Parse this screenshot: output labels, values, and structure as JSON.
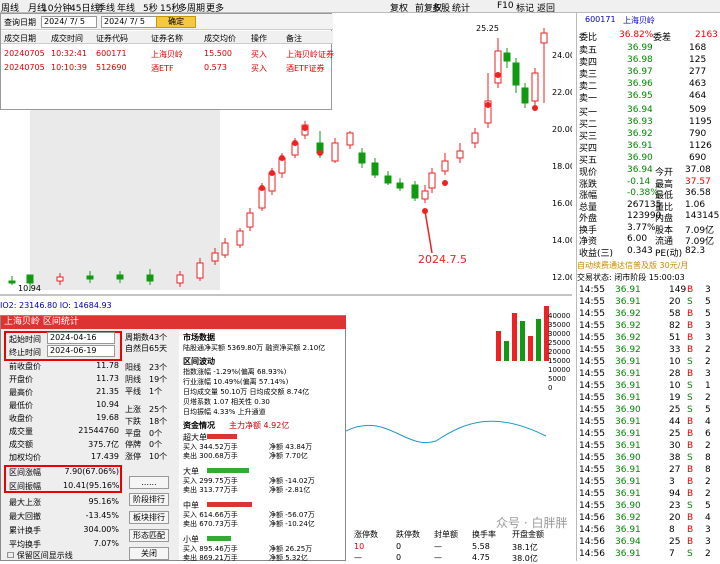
{
  "topbar": [
    "周线",
    "月线",
    "10分钟",
    "45日线",
    "季线",
    "年线",
    "5秒",
    "15秒",
    "多周期",
    "更多",
    "复权",
    "前复权",
    "多股",
    "统计",
    "F10",
    "标记",
    "返回"
  ],
  "query": {
    "label": "查询日期",
    "date1": "2024/ 7/ 5",
    "date2": "2024/ 7/ 5",
    "confirm": "确定",
    "headers": [
      "成交日期",
      "成交时间",
      "证券代码",
      "证券名称",
      "成交均价",
      "操作",
      "备注"
    ],
    "rows": [
      [
        "20240705",
        "10:32:41",
        "600171",
        "上海贝岭",
        "15.500",
        "买入",
        "上海贝岭证券"
      ],
      [
        "20240705",
        "10:10:39",
        "512690",
        "酒ETF",
        "0.573",
        "买入",
        "酒ETF证券"
      ]
    ]
  },
  "chart": {
    "top_label": "25.25",
    "low_label": "10.94",
    "annotation": "2024.7.5",
    "price_ticks": [
      "24.00",
      "22.00",
      "20.00",
      "18.00",
      "16.00",
      "14.00",
      "12.00"
    ],
    "vol_label": "IO2: 23146.80  IO: 14684.93",
    "vol_ticks": [
      "40000",
      "35000",
      "30000",
      "25000",
      "20000",
      "15000",
      "10000",
      "5000",
      "0"
    ]
  },
  "stats": {
    "title": "上海贝岭 区间统计",
    "start_label": "起始时间",
    "start": "2024-04-16",
    "end_label": "终止时间",
    "end": "2024-06-19",
    "left": [
      [
        "前收盘价",
        "11.78"
      ],
      [
        "开盘价",
        "11.73"
      ],
      [
        "最高价",
        "21.35"
      ],
      [
        "最低价",
        "10.94"
      ],
      [
        "收盘价",
        "19.68"
      ],
      [
        "成交量",
        "21544760"
      ],
      [
        "成交额",
        "375.7亿"
      ],
      [
        "加权均价",
        "17.439"
      ],
      [
        "区间涨幅",
        "7.90(67.06%)"
      ],
      [
        "区间振幅",
        "10.41(95.16%)"
      ],
      [
        "最大上涨",
        "95.16%"
      ],
      [
        "最大回撤",
        "-13.45%"
      ],
      [
        "累计换手",
        "304.00%"
      ],
      [
        "平均换手",
        "7.07%"
      ]
    ],
    "show_check": "保留区间显示线",
    "mid": [
      [
        "周期数",
        "43个"
      ],
      [
        "自然日",
        "65天"
      ],
      [
        "阳线",
        "23个"
      ],
      [
        "阴线",
        "19个"
      ],
      [
        "平线",
        "1个"
      ],
      [
        "上涨",
        "25个"
      ],
      [
        "下跌",
        "18个"
      ],
      [
        "平盘",
        "0个"
      ],
      [
        "停牌",
        "0个"
      ],
      [
        "涨停",
        "10个"
      ]
    ],
    "buttons": [
      "......",
      "阶段排行",
      "板块排行",
      "形态匹配",
      "关闭"
    ],
    "market_title": "市场数据",
    "market_line": "陆股通净买额 5369.80万 融资净买额 2.10亿",
    "band_title": "区间波动",
    "band_lines": [
      "指数涨幅 -1.29%(偏离 68.93%)",
      "行业涨幅 10.49%(偏离 57.14%)",
      "日均成交量 50.10万  日均成交额 8.74亿",
      "贝塔系数 1.07  相关性 0.30",
      "日均振幅 4.33%  上升通道"
    ],
    "fund_title": "资金情况",
    "fund_main": "主力净额 4.92亿",
    "funds": [
      [
        "超大单",
        "买入 344.52万手",
        "卖出 300.68万手",
        "净额 43.84万",
        "净额 7.70亿"
      ],
      [
        "大单",
        "买入 299.75万手",
        "卖出 313.77万手",
        "净额 -14.02万",
        "净额 -2.81亿"
      ],
      [
        "中单",
        "买入 614.66万手",
        "卖出 670.73万手",
        "净额 -56.07万",
        "净额 -10.24亿"
      ],
      [
        "小单",
        "买入 895.46万手",
        "卖出 869.21万手",
        "净额 26.25万",
        "净额 5.32亿"
      ]
    ]
  },
  "bottom": {
    "headers": [
      "涨停数",
      "跌停数",
      "封单额",
      "换手率",
      "开盘金额"
    ],
    "vals": [
      "10",
      "0",
      "—",
      "5.58",
      "38.1亿"
    ],
    "vals2": [
      "—",
      "0",
      "—",
      "4.75",
      "38.0亿"
    ],
    "watermark": "众号 · 白胖胖"
  },
  "right": {
    "code": "600171",
    "name": "上海贝岭",
    "weibi": "委比",
    "weibi_v": "36.82%",
    "weicha": "委差",
    "weicha_v": "2163",
    "sells": [
      [
        "卖五",
        "36.99",
        "168"
      ],
      [
        "卖四",
        "36.98",
        "125"
      ],
      [
        "卖三",
        "36.97",
        "277"
      ],
      [
        "卖二",
        "36.96",
        "463"
      ],
      [
        "卖一",
        "36.95",
        "464"
      ]
    ],
    "buys": [
      [
        "买一",
        "36.94",
        "509"
      ],
      [
        "买二",
        "36.93",
        "1195"
      ],
      [
        "买三",
        "36.92",
        "790"
      ],
      [
        "买四",
        "36.91",
        "1126"
      ],
      [
        "买五",
        "36.90",
        "690"
      ]
    ],
    "info": [
      [
        "现价",
        "36.94",
        "今开",
        "37.08"
      ],
      [
        "涨跌",
        "-0.14",
        "最高",
        "37.57"
      ],
      [
        "涨幅",
        "-0.38%",
        "最低",
        "36.58"
      ],
      [
        "总量",
        "267135",
        "量比",
        "1.06"
      ],
      [
        "外盘",
        "123990",
        "内盘",
        "143145"
      ],
      [
        "换手",
        "3.77%",
        "股本",
        "7.09亿"
      ],
      [
        "净资",
        "6.00",
        "流通",
        "7.09亿"
      ],
      [
        "收益(三)",
        "0.343",
        "PE(动)",
        "82.3"
      ]
    ],
    "notice": "自动续费通达信普及版 30元/月",
    "status": "交易状态: 闭市阶段 15:00:03",
    "ticks": [
      [
        "14:55",
        "36.91",
        "149",
        "B",
        "3"
      ],
      [
        "14:55",
        "36.91",
        "20",
        "S",
        "5"
      ],
      [
        "14:55",
        "36.92",
        "58",
        "B",
        "5"
      ],
      [
        "14:55",
        "36.92",
        "82",
        "B",
        "3"
      ],
      [
        "14:55",
        "36.92",
        "51",
        "B",
        "3"
      ],
      [
        "14:55",
        "36.92",
        "33",
        "B",
        "2"
      ],
      [
        "14:55",
        "36.91",
        "10",
        "S",
        "2"
      ],
      [
        "14:55",
        "36.91",
        "28",
        "B",
        "3"
      ],
      [
        "14:55",
        "36.91",
        "10",
        "S",
        "1"
      ],
      [
        "14:55",
        "36.91",
        "19",
        "S",
        "2"
      ],
      [
        "14:55",
        "36.90",
        "25",
        "S",
        "5"
      ],
      [
        "14:55",
        "36.91",
        "44",
        "B",
        "4"
      ],
      [
        "14:55",
        "36.91",
        "25",
        "B",
        "6"
      ],
      [
        "14:55",
        "36.91",
        "30",
        "B",
        "2"
      ],
      [
        "14:55",
        "36.90",
        "38",
        "S",
        "8"
      ],
      [
        "14:55",
        "36.91",
        "27",
        "B",
        "8"
      ],
      [
        "14:55",
        "36.91",
        "3",
        "B",
        "2"
      ],
      [
        "14:55",
        "36.91",
        "94",
        "B",
        "2"
      ],
      [
        "14:55",
        "36.90",
        "23",
        "S",
        "5"
      ],
      [
        "14:56",
        "36.92",
        "20",
        "B",
        "4"
      ],
      [
        "14:56",
        "36.91",
        "8",
        "B",
        "3"
      ],
      [
        "14:56",
        "36.94",
        "25",
        "B",
        "3"
      ],
      [
        "14:56",
        "36.91",
        "7",
        "S",
        "2"
      ]
    ]
  }
}
